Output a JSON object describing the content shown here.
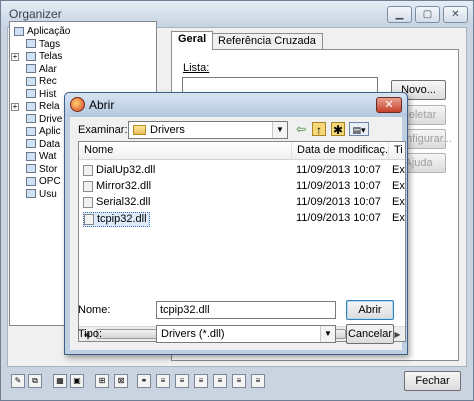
{
  "organizer": {
    "title": "Organizer",
    "tabs": [
      "Geral",
      "Referência Cruzada"
    ],
    "lista_label": "Lista:",
    "buttons": [
      "Novo...",
      "Deletar",
      "Configurar...",
      "Ajuda"
    ],
    "close_button": "Fechar",
    "tree_items": [
      {
        "label": "Aplicação",
        "indent": 0,
        "expander": false
      },
      {
        "label": "Tags",
        "indent": 1,
        "expander": false
      },
      {
        "label": "Telas",
        "indent": 1,
        "expander": true
      },
      {
        "label": "Alar",
        "indent": 1,
        "expander": false
      },
      {
        "label": "Rec",
        "indent": 1,
        "expander": false
      },
      {
        "label": "Hist",
        "indent": 1,
        "expander": false
      },
      {
        "label": "Rela",
        "indent": 1,
        "expander": true
      },
      {
        "label": "Drive",
        "indent": 1,
        "expander": false
      },
      {
        "label": "Aplic",
        "indent": 1,
        "expander": false
      },
      {
        "label": "Data",
        "indent": 1,
        "expander": false
      },
      {
        "label": "Wat",
        "indent": 1,
        "expander": false
      },
      {
        "label": "Stor",
        "indent": 1,
        "expander": false
      },
      {
        "label": "OPC",
        "indent": 1,
        "expander": false
      },
      {
        "label": "Usu",
        "indent": 1,
        "expander": false
      }
    ]
  },
  "dialog": {
    "title": "Abrir",
    "close_glyph": "✕",
    "examinar_label": "Examinar:",
    "current_folder": "Drivers",
    "columns": [
      "Nome",
      "Data de modificaç...",
      "Ti"
    ],
    "files": [
      {
        "name": "DialUp32.dll",
        "date": "11/09/2013 10:07",
        "type": "Ex",
        "selected": false
      },
      {
        "name": "Mirror32.dll",
        "date": "11/09/2013 10:07",
        "type": "Ex",
        "selected": false
      },
      {
        "name": "Serial32.dll",
        "date": "11/09/2013 10:07",
        "type": "Ex",
        "selected": false
      },
      {
        "name": "tcpip32.dll",
        "date": "11/09/2013 10:07",
        "type": "Ex",
        "selected": true
      }
    ],
    "nome_label": "Nome:",
    "nome_value": "tcpip32.dll",
    "tipo_label": "Tipo:",
    "tipo_value": "Drivers (*.dll)",
    "open_button": "Abrir",
    "cancel_button": "Cancelar"
  }
}
